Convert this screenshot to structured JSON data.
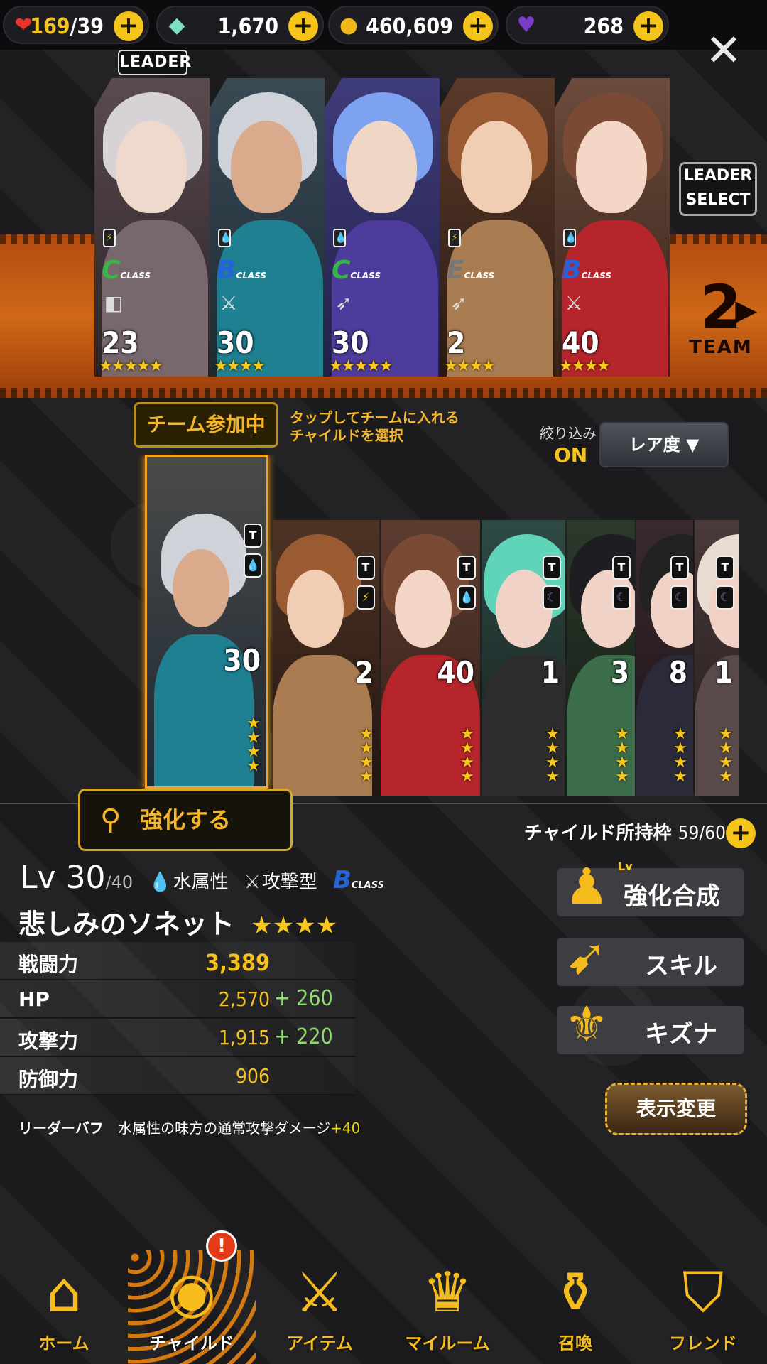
{
  "topbar": {
    "hp": {
      "icon": "heart-icon",
      "current": "169",
      "max": "/39"
    },
    "gems": {
      "icon": "rainbow-gem-icon",
      "value": "1,670"
    },
    "coins": {
      "icon": "gold-coin-icon",
      "value": "460,609"
    },
    "crystals": {
      "icon": "purple-heart-gem-icon",
      "value": "268"
    }
  },
  "team": {
    "leader_tag": "LEADER",
    "leader_select": "LEADER SELECT",
    "team_number": "2",
    "team_label": "TEAM",
    "members": [
      {
        "class": "C",
        "level": "23",
        "stars": 5,
        "attr": "lightning",
        "type": "shield"
      },
      {
        "class": "B",
        "level": "30",
        "stars": 4,
        "attr": "water",
        "type": "crossed-swords"
      },
      {
        "class": "C",
        "level": "30",
        "stars": 5,
        "attr": "water",
        "type": "wing"
      },
      {
        "class": "E",
        "level": "2",
        "stars": 4,
        "attr": "lightning",
        "type": "wing"
      },
      {
        "class": "B",
        "level": "40",
        "stars": 4,
        "attr": "water",
        "type": "crossed-swords"
      }
    ],
    "class_suffix": "CLASS"
  },
  "selection": {
    "in_team_badge": "チーム参加中",
    "tap_hint_line1": "タップしてチームに入れる",
    "tap_hint_line2": "チャイルドを選択",
    "filter_label": "絞り込み",
    "filter_state": "ON",
    "sort_select": "レア度 ▼",
    "children": [
      {
        "level": "30",
        "stars": 4,
        "selected": true
      },
      {
        "level": "2",
        "stars": 4
      },
      {
        "level": "40",
        "stars": 4
      },
      {
        "level": "1",
        "stars": 4
      },
      {
        "level": "3",
        "stars": 4
      },
      {
        "level": "8",
        "stars": 4
      },
      {
        "level": "1",
        "stars": 4
      }
    ],
    "t_badge": "T",
    "enhance_button": "強化する"
  },
  "details": {
    "slots_label": "チャイルド所持枠",
    "slots_count": "59/60",
    "lv_prefix": "Lv",
    "level": "30",
    "max_level": "/40",
    "attribute": "水属性",
    "role": "攻撃型",
    "class": "B",
    "class_suffix": "CLASS",
    "name": "悲しみのソネット",
    "stars": "★★★★",
    "stats": [
      {
        "label": "戦闘力",
        "value": "3,389",
        "bonus": ""
      },
      {
        "label": "HP",
        "value": "2,570",
        "bonus": "+ 260"
      },
      {
        "label": "攻撃力",
        "value": "1,915",
        "bonus": "+ 220"
      },
      {
        "label": "防御力",
        "value": "906",
        "bonus": ""
      }
    ],
    "leader_buff_label": "リーダーバフ",
    "leader_buff_text": "水属性の味方の通常攻撃ダメージ",
    "leader_buff_value": "+40"
  },
  "side_buttons": {
    "fusion": "強化合成",
    "fusion_badge": "Lv",
    "skill": "スキル",
    "bond": "キズナ",
    "view_change": "表示変更"
  },
  "nav": [
    {
      "label": "ホーム",
      "icon": "home-arch-icon"
    },
    {
      "label": "チャイルド",
      "icon": "flame-eye-icon",
      "active": true
    },
    {
      "label": "アイテム",
      "icon": "sword-shield-icon"
    },
    {
      "label": "マイルーム",
      "icon": "crown-wreath-icon"
    },
    {
      "label": "召喚",
      "icon": "summon-bottle-icon"
    },
    {
      "label": "フレンド",
      "icon": "friend-shield-icon"
    }
  ],
  "nav_alert": "!",
  "colors": {
    "accent": "#f6c31d",
    "team_band": "#d06818",
    "class_B": "#2563d9",
    "class_C": "#39b54a",
    "class_E": "#777777",
    "bonus_green": "#8ddb6b"
  }
}
